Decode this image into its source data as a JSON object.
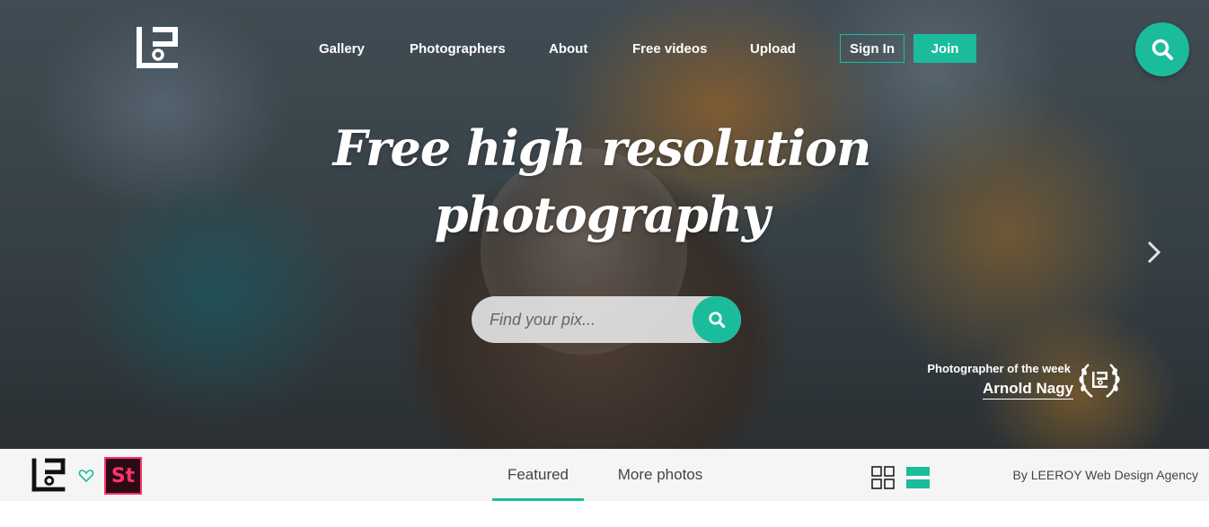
{
  "header": {
    "nav": [
      "Gallery",
      "Photographers",
      "About",
      "Free videos",
      "Upload"
    ],
    "sign_in": "Sign In",
    "join": "Join"
  },
  "hero": {
    "headline_line1": "Free high resolution",
    "headline_line2": "photography",
    "search_placeholder": "Find your pix...",
    "photographer_of_week_label": "Photographer of the week",
    "photographer_name": "Arnold Nagy"
  },
  "bottom_bar": {
    "st_badge": "St",
    "tabs": [
      "Featured",
      "More photos"
    ],
    "active_tab": "Featured",
    "credit": "By LEEROY Web Design Agency"
  },
  "colors": {
    "accent": "#1abc9c",
    "stock_badge": "#ff3366"
  },
  "icons": [
    "logo-icon",
    "search-icon",
    "chevron-right-icon",
    "wreath-icon",
    "heart-icon",
    "grid-view-icon",
    "list-view-icon"
  ]
}
